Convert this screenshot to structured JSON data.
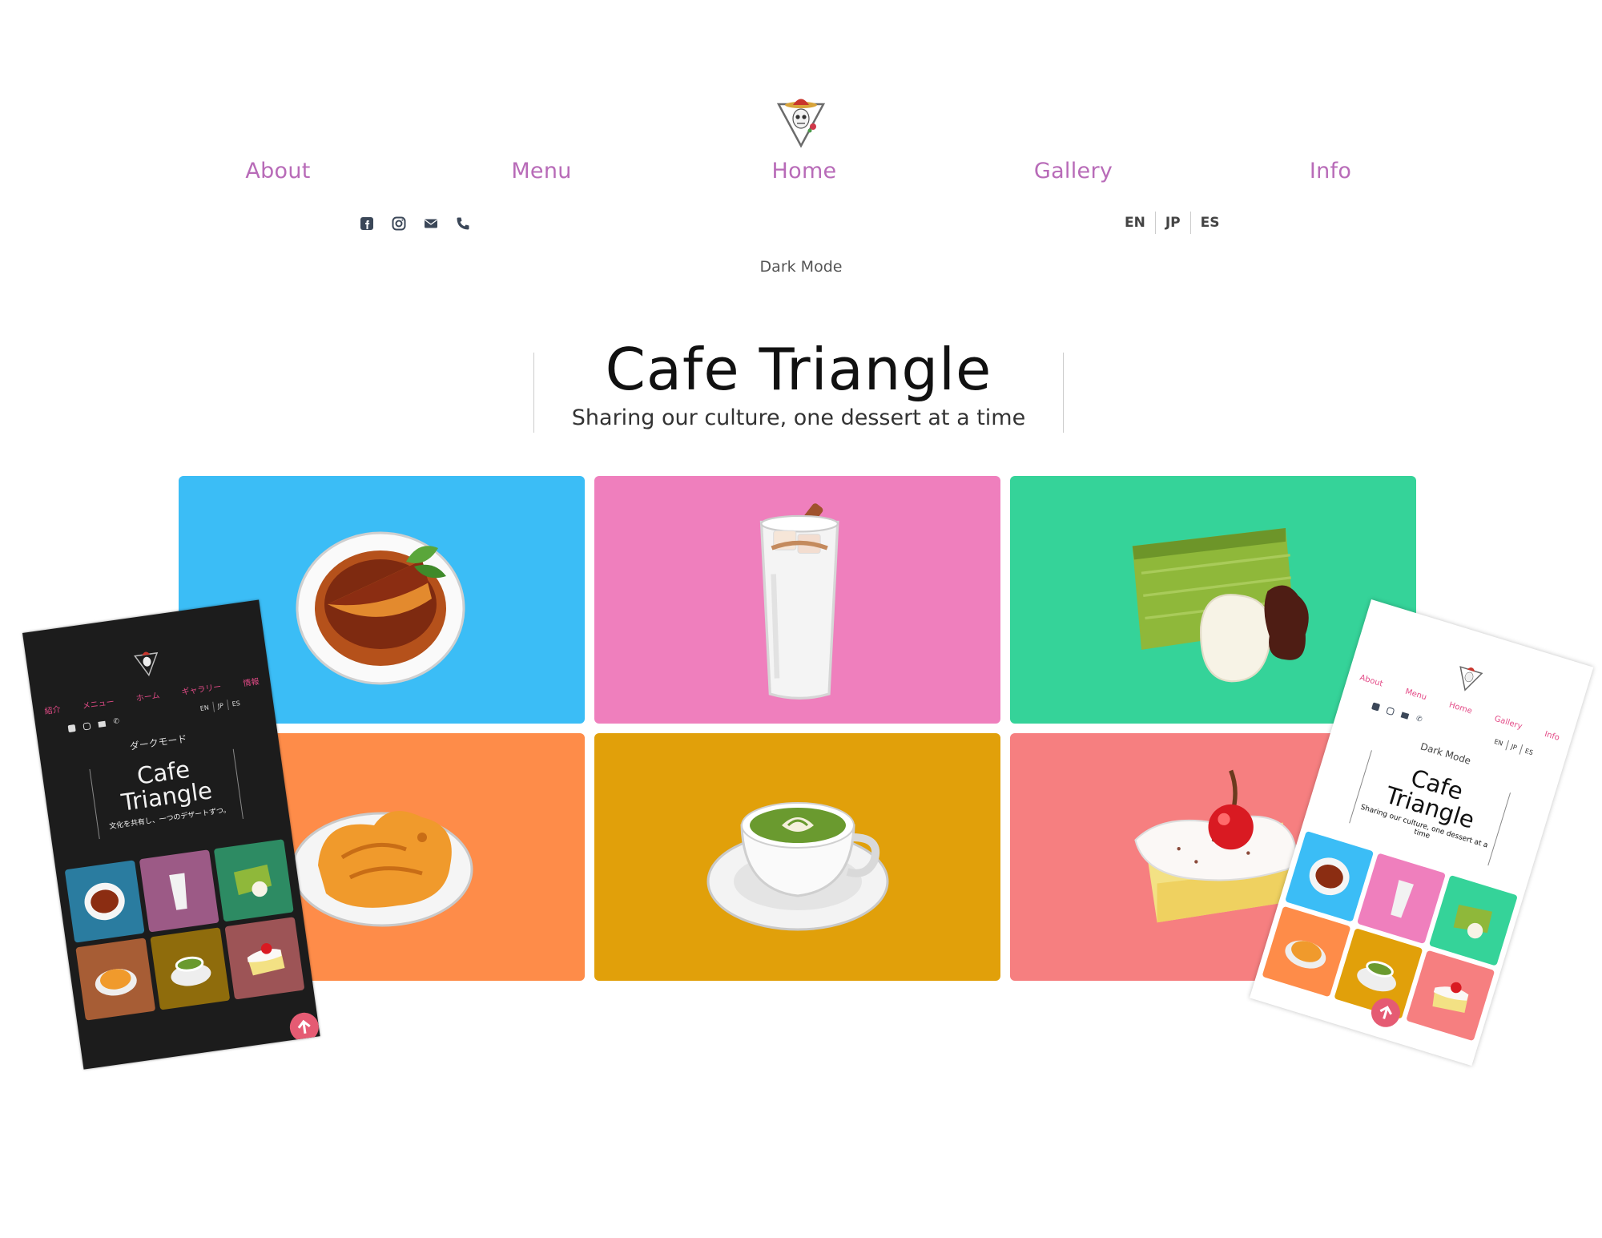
{
  "nav": {
    "items": [
      {
        "label": "About"
      },
      {
        "label": "Menu"
      },
      {
        "label": "Home"
      },
      {
        "label": "Gallery"
      },
      {
        "label": "Info"
      }
    ]
  },
  "social": [
    "facebook-icon",
    "instagram-icon",
    "mail-icon",
    "phone-icon"
  ],
  "languages": [
    "EN",
    "JP",
    "ES"
  ],
  "dark_mode_label": "Dark Mode",
  "hero": {
    "title": "Cafe Triangle",
    "subtitle": "Sharing our culture, one dessert at a time"
  },
  "tiles": [
    {
      "item": "pie-icon",
      "color": "#3bbdf6"
    },
    {
      "item": "iced-drink-icon",
      "color": "#ef7fbd"
    },
    {
      "item": "matcha-cake-icon",
      "color": "#35d399"
    },
    {
      "item": "taiyaki-icon",
      "color": "#fe8c49"
    },
    {
      "item": "matcha-latte-icon",
      "color": "#e1a00a"
    },
    {
      "item": "cherry-cake-icon",
      "color": "#f67f80"
    }
  ],
  "mobile_dark": {
    "nav": [
      "紹介",
      "メニュー",
      "ホーム",
      "ギャラリー",
      "情報"
    ],
    "languages": [
      "EN",
      "JP",
      "ES"
    ],
    "dark_mode_label": "ダークモード",
    "title": "Cafe Triangle",
    "subtitle": "文化を共有し、一つのデザートずつ。",
    "tile_colors": [
      "#2a7ca0",
      "#9c5a86",
      "#2d8b63",
      "#a75d35",
      "#8f6c0c",
      "#9d5456"
    ]
  },
  "mobile_light": {
    "nav": [
      "About",
      "Menu",
      "Home",
      "Gallery",
      "Info"
    ],
    "languages": [
      "EN",
      "JP",
      "ES"
    ],
    "dark_mode_label": "Dark Mode",
    "title": "Cafe Triangle",
    "subtitle": "Sharing our culture, one dessert at a time",
    "tile_colors": [
      "#3bbdf6",
      "#ef7fbd",
      "#35d399",
      "#fe8c49",
      "#e1a00a",
      "#f67f80"
    ]
  }
}
